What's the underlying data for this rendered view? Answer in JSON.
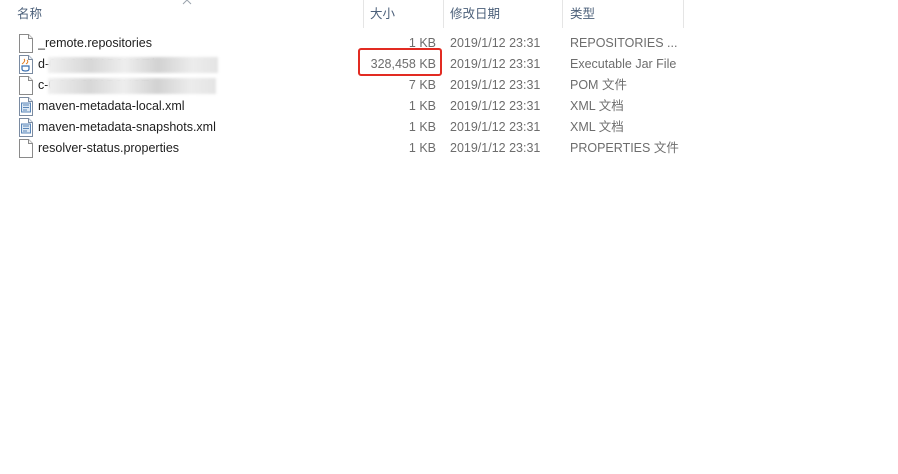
{
  "columns": {
    "name": "名称",
    "size": "大小",
    "modified": "修改日期",
    "type": "类型"
  },
  "files": [
    {
      "name": "_remote.repositories",
      "size": "1 KB",
      "modified": "2019/1/12 23:31",
      "type": "REPOSITORIES ...",
      "icon": "generic-file-icon"
    },
    {
      "name": "d-0.0.6-SNAPSHOT.jar",
      "size": "328,458 KB",
      "modified": "2019/1/12 23:31",
      "type": "Executable Jar File",
      "icon": "jar-file-icon"
    },
    {
      "name": "c-0.0.6-SNAPSHOT.pom",
      "size": "7 KB",
      "modified": "2019/1/12 23:31",
      "type": "POM 文件",
      "icon": "generic-file-icon"
    },
    {
      "name": "maven-metadata-local.xml",
      "size": "1 KB",
      "modified": "2019/1/12 23:31",
      "type": "XML 文档",
      "icon": "xml-file-icon"
    },
    {
      "name": "maven-metadata-snapshots.xml",
      "size": "1 KB",
      "modified": "2019/1/12 23:31",
      "type": "XML 文档",
      "icon": "xml-file-icon"
    },
    {
      "name": "resolver-status.properties",
      "size": "1 KB",
      "modified": "2019/1/12 23:31",
      "type": "PROPERTIES 文件",
      "icon": "generic-file-icon"
    }
  ],
  "colors": {
    "highlight": "#e22b22",
    "header_text": "#4c607a"
  }
}
